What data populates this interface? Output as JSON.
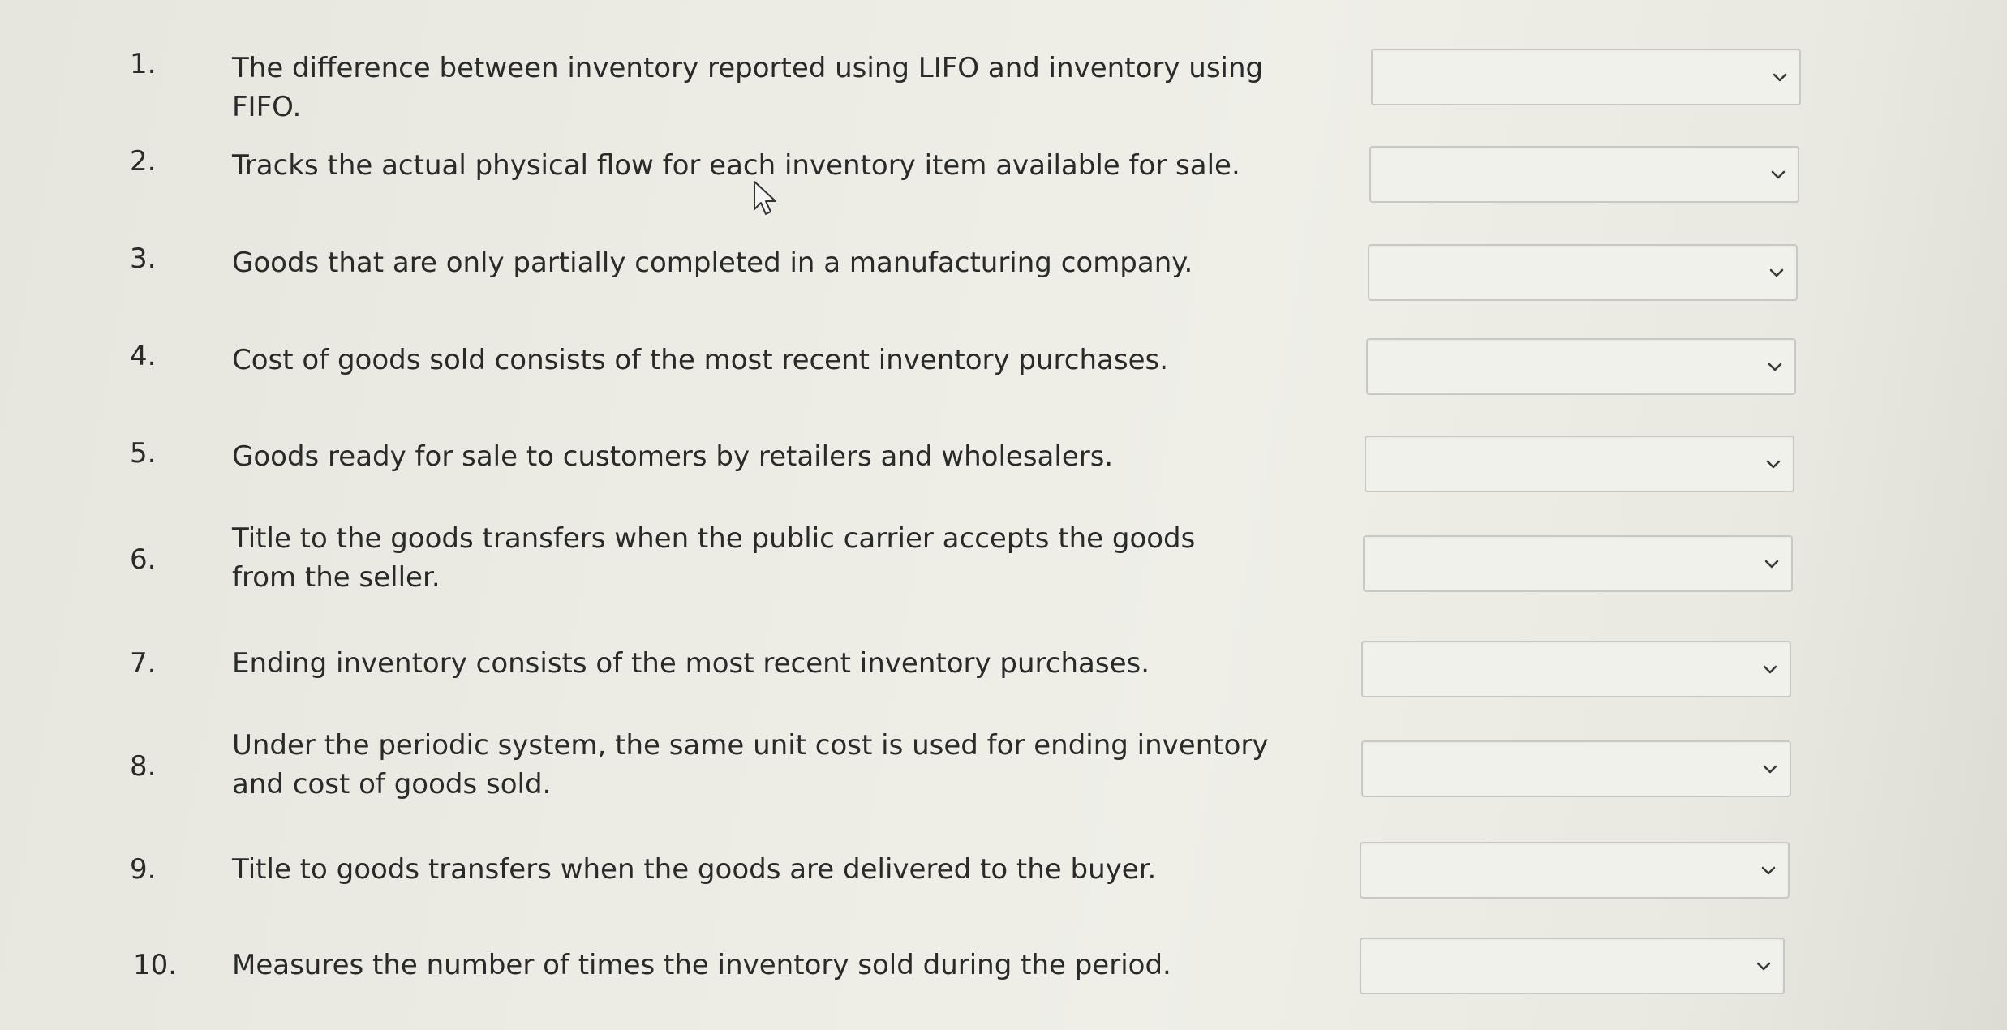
{
  "questions": [
    {
      "number": "1.",
      "text": "The difference between inventory reported using LIFO and inventory using FIFO.",
      "selected": ""
    },
    {
      "number": "2.",
      "text": "Tracks the actual physical flow for each inventory item available for sale.",
      "selected": ""
    },
    {
      "number": "3.",
      "text": "Goods that are only partially completed in a manufacturing company.",
      "selected": ""
    },
    {
      "number": "4.",
      "text": "Cost of goods sold consists of the most recent inventory purchases.",
      "selected": ""
    },
    {
      "number": "5.",
      "text": "Goods ready for sale to customers by retailers and wholesalers.",
      "selected": ""
    },
    {
      "number": "6.",
      "text": "Title to the goods transfers when the public carrier accepts the goods from the seller.",
      "selected": ""
    },
    {
      "number": "7.",
      "text": "Ending inventory consists of the most recent inventory purchases.",
      "selected": ""
    },
    {
      "number": "8.",
      "text": "Under the periodic system, the same unit cost is used for ending inventory and cost of goods sold.",
      "selected": ""
    },
    {
      "number": "9.",
      "text": "Title to goods transfers when the goods are delivered to the buyer.",
      "selected": ""
    },
    {
      "number": "10.",
      "text": "Measures the number of times the inventory sold during the period.",
      "selected": ""
    }
  ],
  "icons": {
    "dropdown": "chevron-down-icon",
    "cursor": "mouse-pointer-icon"
  },
  "colors": {
    "text": "#2a2a2a",
    "select_border": "#c9c9c3",
    "select_bg": "#f1f1ec",
    "chevron": "#3a3a3a"
  }
}
